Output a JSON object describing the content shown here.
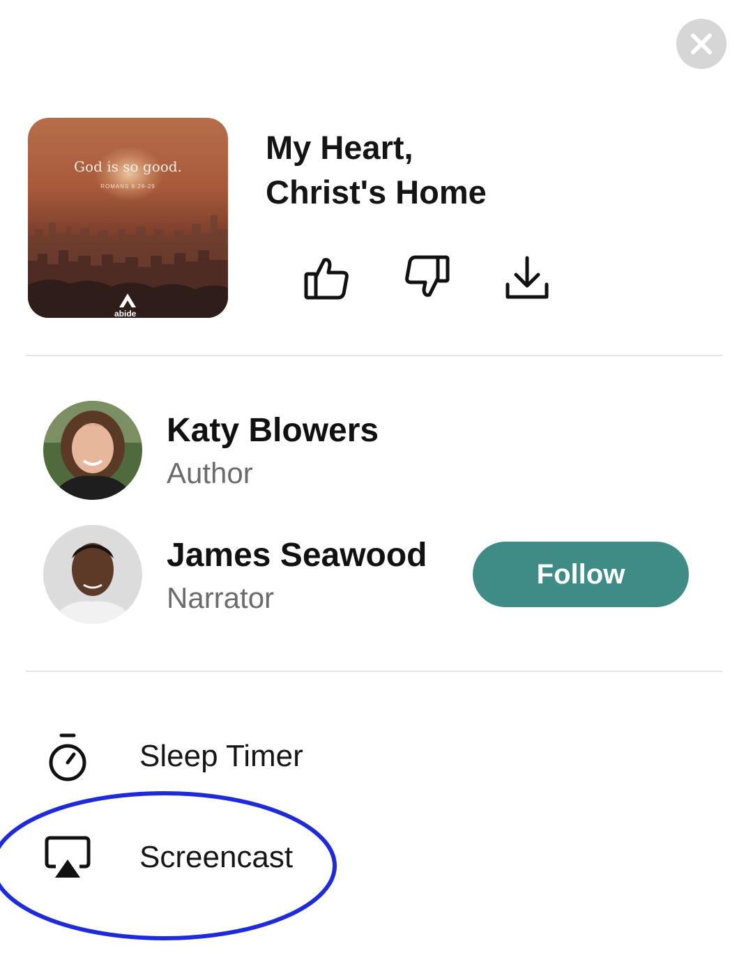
{
  "header": {
    "close_icon": "close-icon"
  },
  "artwork": {
    "title": "God is so good.",
    "reference": "ROMANS 8:28-29",
    "brand": "abide"
  },
  "track": {
    "title_line1": "My Heart,",
    "title_line2": "Christ's Home",
    "actions": [
      {
        "icon": "thumbs-up-icon"
      },
      {
        "icon": "thumbs-down-icon"
      },
      {
        "icon": "download-icon"
      }
    ]
  },
  "credits": [
    {
      "name": "Katy Blowers",
      "role": "Author"
    },
    {
      "name": "James Seawood",
      "role": "Narrator",
      "button": "Follow"
    }
  ],
  "menu": {
    "items": [
      {
        "label": "Sleep Timer",
        "icon": "stopwatch-icon"
      },
      {
        "label": "Screencast",
        "icon": "airplay-icon"
      }
    ]
  },
  "colors": {
    "accent": "#3f8b85",
    "highlight": "#1f2bd9",
    "close_bg": "#d6d6d6"
  }
}
